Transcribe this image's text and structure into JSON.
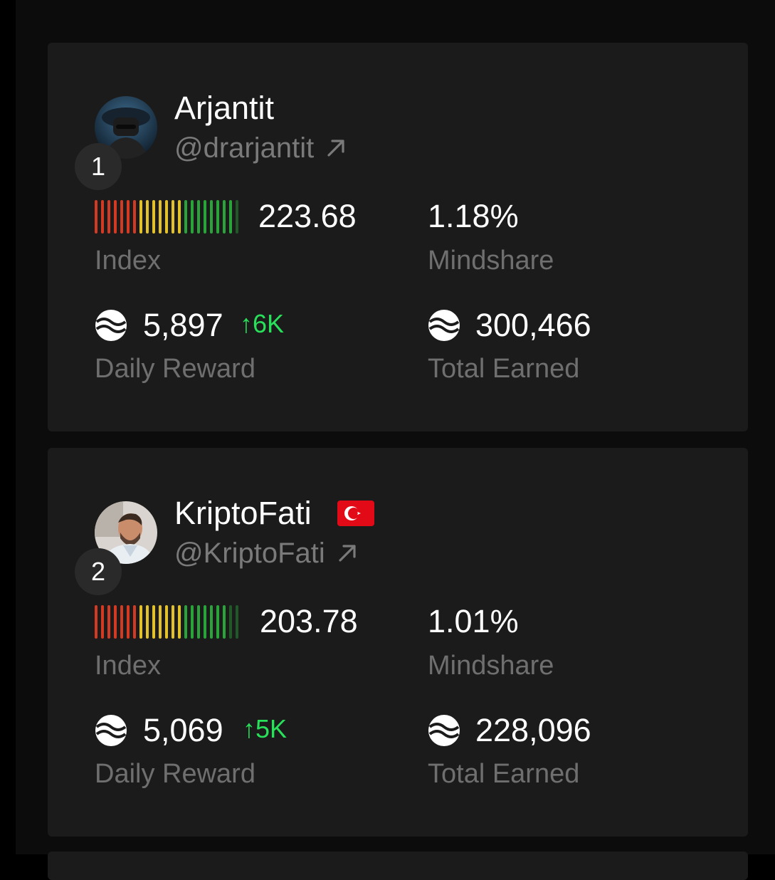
{
  "colors": {
    "background": "#000000",
    "card": "#1b1b1b",
    "text_primary": "#ffffff",
    "text_muted": "#6f6f6f",
    "delta_up": "#28e05a",
    "index_scale": [
      "#d33a24",
      "#e3c12b",
      "#2aa33a"
    ]
  },
  "icons": {
    "external_link": "arrow-up-right-icon",
    "reward_token": "token-coin-icon",
    "trend_up": "arrow-up-icon"
  },
  "entries": [
    {
      "rank": "1",
      "name": "Arjantit",
      "flag": "",
      "handle": "@drarjantit",
      "index_value": "223.68",
      "index_label": "Index",
      "index_level": 0.97,
      "mindshare_value": "1.18%",
      "mindshare_label": "Mindshare",
      "daily_reward_value": "5,897",
      "daily_reward_delta": "↑6K",
      "daily_reward_label": "Daily Reward",
      "total_earned_value": "300,466",
      "total_earned_label": "Total Earned"
    },
    {
      "rank": "2",
      "name": "KriptoFati",
      "flag": "turkey-flag",
      "handle": "@KriptoFati",
      "index_value": "203.78",
      "index_label": "Index",
      "index_level": 0.92,
      "mindshare_value": "1.01%",
      "mindshare_label": "Mindshare",
      "daily_reward_value": "5,069",
      "daily_reward_delta": "↑5K",
      "daily_reward_label": "Daily Reward",
      "total_earned_value": "228,096",
      "total_earned_label": "Total Earned"
    }
  ]
}
